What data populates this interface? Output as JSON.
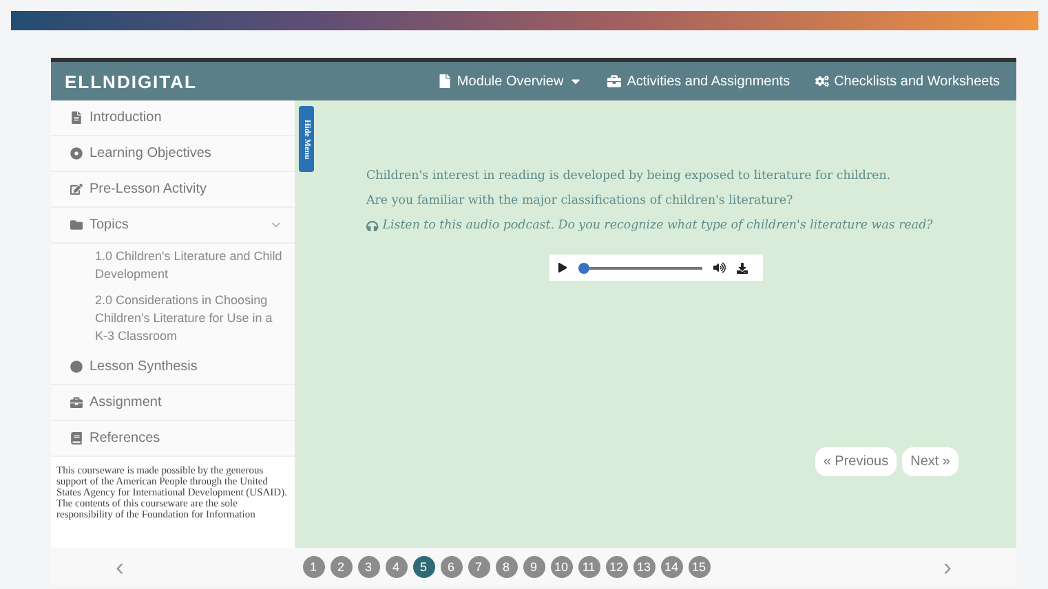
{
  "header": {
    "logo": "ELLNDIGITAL",
    "nav": [
      {
        "label": "Module Overview",
        "dropdown": true
      },
      {
        "label": "Activities and Assignments",
        "dropdown": false
      },
      {
        "label": "Checklists and Worksheets",
        "dropdown": false
      }
    ]
  },
  "sidebar": {
    "items": [
      {
        "label": "Introduction"
      },
      {
        "label": "Learning Objectives"
      },
      {
        "label": "Pre-Lesson Activity"
      },
      {
        "label": "Topics",
        "expanded": true,
        "children": [
          {
            "label": "1.0 Children's Literature and Child Development"
          },
          {
            "label": "2.0 Considerations in Choosing Children's Literature for Use in a K-3 Classroom"
          }
        ]
      },
      {
        "label": "Lesson Synthesis"
      },
      {
        "label": "Assignment"
      },
      {
        "label": "References"
      }
    ],
    "note": "This courseware is made possible by the generous support of the American People through the United States Agency for International Development (USAID). The contents of this courseware are the sole responsibility of the Foundation for Information"
  },
  "hide_menu": "Hide Menu",
  "content": {
    "paragraphs": [
      {
        "text": "Children's interest in reading is developed by being exposed to literature for children.",
        "italic": false
      },
      {
        "text": "Are you familiar with the major classifications of children's literature?",
        "italic": false
      },
      {
        "text": "Listen to this audio podcast. Do you recognize what type of children's literature was read?",
        "italic": true
      }
    ],
    "audio": {
      "level": 0.0
    },
    "buttons": [
      "« Previous",
      "Next »"
    ]
  },
  "pager": {
    "prev": "‹",
    "next": "›",
    "pages": [
      {
        "label": "1",
        "selected": false
      },
      {
        "label": "2",
        "selected": false
      },
      {
        "label": "3",
        "selected": false
      },
      {
        "label": "4",
        "selected": false
      },
      {
        "label": "5",
        "selected": true
      },
      {
        "label": "6",
        "selected": false
      },
      {
        "label": "7",
        "selected": false
      },
      {
        "label": "8",
        "selected": false
      },
      {
        "label": "9",
        "selected": false
      },
      {
        "label": "10",
        "selected": false
      },
      {
        "label": "11",
        "selected": false
      },
      {
        "label": "12",
        "selected": false
      },
      {
        "label": "13",
        "selected": false
      },
      {
        "label": "14",
        "selected": false
      },
      {
        "label": "15",
        "selected": false
      }
    ]
  }
}
